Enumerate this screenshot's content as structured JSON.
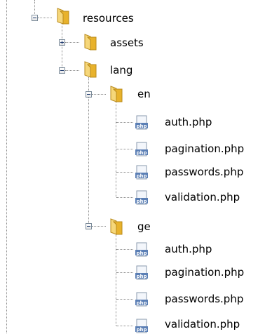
{
  "tree": {
    "root": {
      "label": "resources",
      "icon": "folder-icon",
      "state": "expanded"
    },
    "nodes": [
      {
        "id": "assets",
        "label": "assets",
        "icon": "folder-icon",
        "state": "collapsed"
      },
      {
        "id": "lang",
        "label": "lang",
        "icon": "folder-icon",
        "state": "expanded"
      },
      {
        "id": "en",
        "label": "en",
        "icon": "folder-icon",
        "state": "expanded",
        "files": [
          "auth.php",
          "pagination.php",
          "passwords.php",
          "validation.php"
        ]
      },
      {
        "id": "ge",
        "label": "ge",
        "icon": "folder-icon",
        "state": "expanded",
        "files": [
          "auth.php",
          "pagination.php",
          "passwords.php",
          "validation.php"
        ]
      }
    ],
    "file_icon": "php-file-icon",
    "file_icon_text": "php"
  },
  "colors": {
    "background": "#ffffff",
    "dotted_lines": "#8c8c8c",
    "folder": "#e8b22c",
    "php_badge": "#5b7fb5"
  }
}
